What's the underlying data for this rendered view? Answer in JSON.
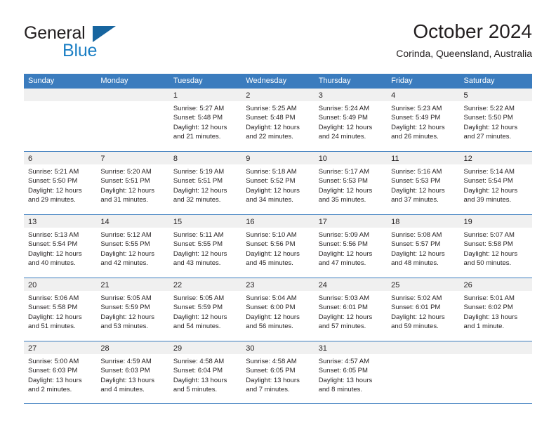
{
  "brand": {
    "name_top": "General",
    "name_bottom": "Blue",
    "accent_color": "#1c7fc4",
    "triangle_color": "#17659f"
  },
  "header": {
    "title": "October 2024",
    "location": "Corinda, Queensland, Australia"
  },
  "calendar": {
    "header_bg": "#3b7cbe",
    "daynum_band_bg": "#f0f0f0",
    "weekday_labels": [
      "Sunday",
      "Monday",
      "Tuesday",
      "Wednesday",
      "Thursday",
      "Friday",
      "Saturday"
    ],
    "weeks": [
      [
        {
          "day": "",
          "sunrise": "",
          "sunset": "",
          "daylight1": "",
          "daylight2": ""
        },
        {
          "day": "",
          "sunrise": "",
          "sunset": "",
          "daylight1": "",
          "daylight2": ""
        },
        {
          "day": "1",
          "sunrise": "Sunrise: 5:27 AM",
          "sunset": "Sunset: 5:48 PM",
          "daylight1": "Daylight: 12 hours",
          "daylight2": "and 21 minutes."
        },
        {
          "day": "2",
          "sunrise": "Sunrise: 5:25 AM",
          "sunset": "Sunset: 5:48 PM",
          "daylight1": "Daylight: 12 hours",
          "daylight2": "and 22 minutes."
        },
        {
          "day": "3",
          "sunrise": "Sunrise: 5:24 AM",
          "sunset": "Sunset: 5:49 PM",
          "daylight1": "Daylight: 12 hours",
          "daylight2": "and 24 minutes."
        },
        {
          "day": "4",
          "sunrise": "Sunrise: 5:23 AM",
          "sunset": "Sunset: 5:49 PM",
          "daylight1": "Daylight: 12 hours",
          "daylight2": "and 26 minutes."
        },
        {
          "day": "5",
          "sunrise": "Sunrise: 5:22 AM",
          "sunset": "Sunset: 5:50 PM",
          "daylight1": "Daylight: 12 hours",
          "daylight2": "and 27 minutes."
        }
      ],
      [
        {
          "day": "6",
          "sunrise": "Sunrise: 5:21 AM",
          "sunset": "Sunset: 5:50 PM",
          "daylight1": "Daylight: 12 hours",
          "daylight2": "and 29 minutes."
        },
        {
          "day": "7",
          "sunrise": "Sunrise: 5:20 AM",
          "sunset": "Sunset: 5:51 PM",
          "daylight1": "Daylight: 12 hours",
          "daylight2": "and 31 minutes."
        },
        {
          "day": "8",
          "sunrise": "Sunrise: 5:19 AM",
          "sunset": "Sunset: 5:51 PM",
          "daylight1": "Daylight: 12 hours",
          "daylight2": "and 32 minutes."
        },
        {
          "day": "9",
          "sunrise": "Sunrise: 5:18 AM",
          "sunset": "Sunset: 5:52 PM",
          "daylight1": "Daylight: 12 hours",
          "daylight2": "and 34 minutes."
        },
        {
          "day": "10",
          "sunrise": "Sunrise: 5:17 AM",
          "sunset": "Sunset: 5:53 PM",
          "daylight1": "Daylight: 12 hours",
          "daylight2": "and 35 minutes."
        },
        {
          "day": "11",
          "sunrise": "Sunrise: 5:16 AM",
          "sunset": "Sunset: 5:53 PM",
          "daylight1": "Daylight: 12 hours",
          "daylight2": "and 37 minutes."
        },
        {
          "day": "12",
          "sunrise": "Sunrise: 5:14 AM",
          "sunset": "Sunset: 5:54 PM",
          "daylight1": "Daylight: 12 hours",
          "daylight2": "and 39 minutes."
        }
      ],
      [
        {
          "day": "13",
          "sunrise": "Sunrise: 5:13 AM",
          "sunset": "Sunset: 5:54 PM",
          "daylight1": "Daylight: 12 hours",
          "daylight2": "and 40 minutes."
        },
        {
          "day": "14",
          "sunrise": "Sunrise: 5:12 AM",
          "sunset": "Sunset: 5:55 PM",
          "daylight1": "Daylight: 12 hours",
          "daylight2": "and 42 minutes."
        },
        {
          "day": "15",
          "sunrise": "Sunrise: 5:11 AM",
          "sunset": "Sunset: 5:55 PM",
          "daylight1": "Daylight: 12 hours",
          "daylight2": "and 43 minutes."
        },
        {
          "day": "16",
          "sunrise": "Sunrise: 5:10 AM",
          "sunset": "Sunset: 5:56 PM",
          "daylight1": "Daylight: 12 hours",
          "daylight2": "and 45 minutes."
        },
        {
          "day": "17",
          "sunrise": "Sunrise: 5:09 AM",
          "sunset": "Sunset: 5:56 PM",
          "daylight1": "Daylight: 12 hours",
          "daylight2": "and 47 minutes."
        },
        {
          "day": "18",
          "sunrise": "Sunrise: 5:08 AM",
          "sunset": "Sunset: 5:57 PM",
          "daylight1": "Daylight: 12 hours",
          "daylight2": "and 48 minutes."
        },
        {
          "day": "19",
          "sunrise": "Sunrise: 5:07 AM",
          "sunset": "Sunset: 5:58 PM",
          "daylight1": "Daylight: 12 hours",
          "daylight2": "and 50 minutes."
        }
      ],
      [
        {
          "day": "20",
          "sunrise": "Sunrise: 5:06 AM",
          "sunset": "Sunset: 5:58 PM",
          "daylight1": "Daylight: 12 hours",
          "daylight2": "and 51 minutes."
        },
        {
          "day": "21",
          "sunrise": "Sunrise: 5:05 AM",
          "sunset": "Sunset: 5:59 PM",
          "daylight1": "Daylight: 12 hours",
          "daylight2": "and 53 minutes."
        },
        {
          "day": "22",
          "sunrise": "Sunrise: 5:05 AM",
          "sunset": "Sunset: 5:59 PM",
          "daylight1": "Daylight: 12 hours",
          "daylight2": "and 54 minutes."
        },
        {
          "day": "23",
          "sunrise": "Sunrise: 5:04 AM",
          "sunset": "Sunset: 6:00 PM",
          "daylight1": "Daylight: 12 hours",
          "daylight2": "and 56 minutes."
        },
        {
          "day": "24",
          "sunrise": "Sunrise: 5:03 AM",
          "sunset": "Sunset: 6:01 PM",
          "daylight1": "Daylight: 12 hours",
          "daylight2": "and 57 minutes."
        },
        {
          "day": "25",
          "sunrise": "Sunrise: 5:02 AM",
          "sunset": "Sunset: 6:01 PM",
          "daylight1": "Daylight: 12 hours",
          "daylight2": "and 59 minutes."
        },
        {
          "day": "26",
          "sunrise": "Sunrise: 5:01 AM",
          "sunset": "Sunset: 6:02 PM",
          "daylight1": "Daylight: 13 hours",
          "daylight2": "and 1 minute."
        }
      ],
      [
        {
          "day": "27",
          "sunrise": "Sunrise: 5:00 AM",
          "sunset": "Sunset: 6:03 PM",
          "daylight1": "Daylight: 13 hours",
          "daylight2": "and 2 minutes."
        },
        {
          "day": "28",
          "sunrise": "Sunrise: 4:59 AM",
          "sunset": "Sunset: 6:03 PM",
          "daylight1": "Daylight: 13 hours",
          "daylight2": "and 4 minutes."
        },
        {
          "day": "29",
          "sunrise": "Sunrise: 4:58 AM",
          "sunset": "Sunset: 6:04 PM",
          "daylight1": "Daylight: 13 hours",
          "daylight2": "and 5 minutes."
        },
        {
          "day": "30",
          "sunrise": "Sunrise: 4:58 AM",
          "sunset": "Sunset: 6:05 PM",
          "daylight1": "Daylight: 13 hours",
          "daylight2": "and 7 minutes."
        },
        {
          "day": "31",
          "sunrise": "Sunrise: 4:57 AM",
          "sunset": "Sunset: 6:05 PM",
          "daylight1": "Daylight: 13 hours",
          "daylight2": "and 8 minutes."
        },
        {
          "day": "",
          "sunrise": "",
          "sunset": "",
          "daylight1": "",
          "daylight2": ""
        },
        {
          "day": "",
          "sunrise": "",
          "sunset": "",
          "daylight1": "",
          "daylight2": ""
        }
      ]
    ]
  }
}
